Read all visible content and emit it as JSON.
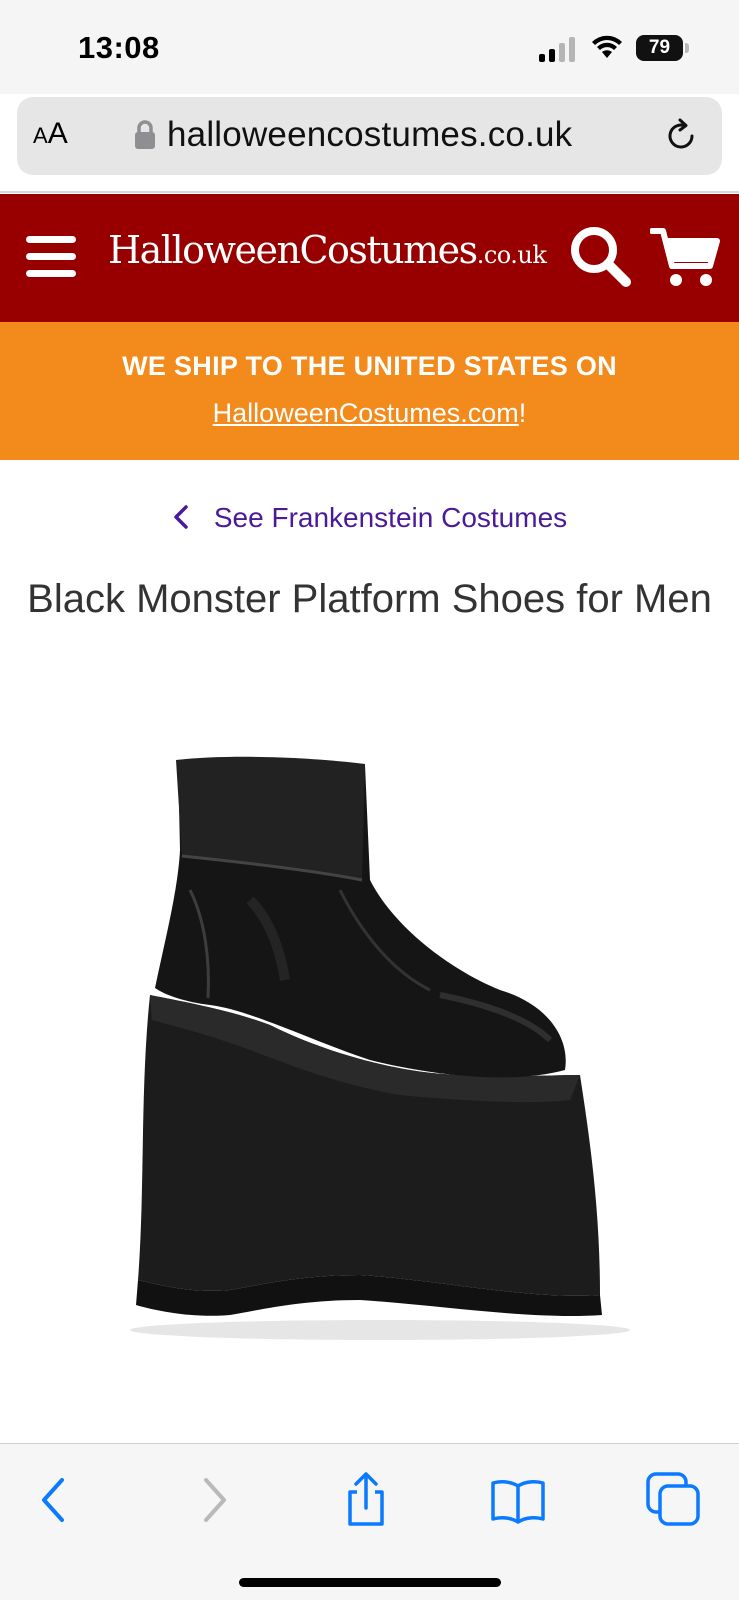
{
  "status_bar": {
    "time": "13:08",
    "battery": "79"
  },
  "browser": {
    "text_size_label_small": "A",
    "text_size_label_large": "A",
    "url": "halloweencostumes.co.uk"
  },
  "header": {
    "logo_main": "HalloweenCostumes",
    "logo_tld": ".co.uk",
    "brand_color": "#980000"
  },
  "promo": {
    "line1": "WE SHIP TO THE UNITED STATES ON",
    "link": "HalloweenCostumes.com",
    "suffix": "!",
    "color": "#f28a1c"
  },
  "breadcrumb": {
    "label": "See Frankenstein Costumes",
    "color": "#4a1a99"
  },
  "product": {
    "title": "Black Monster Platform Shoes for Men"
  },
  "toolbar": {
    "icons": [
      "back-icon",
      "forward-icon",
      "share-icon",
      "bookmarks-icon",
      "tabs-icon"
    ],
    "accent": "#0a7aff"
  }
}
